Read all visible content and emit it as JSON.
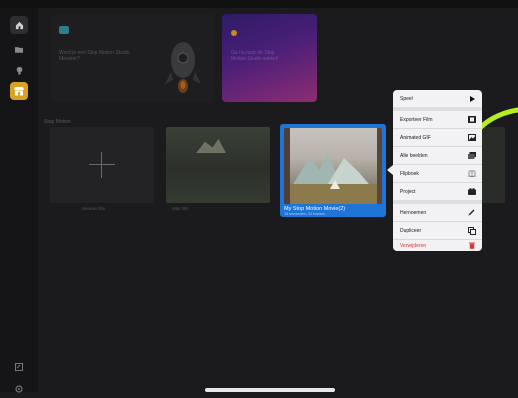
{
  "section_title": "Stop Motion",
  "new_tile_label": "Nieuwe film",
  "banner1_text": "Word je een Stop Motion Studio Meester?",
  "banner2_text": "Ga nu naar de Stop Motion Studio winkel!",
  "tiles": {
    "movie1_label": "Mijn film"
  },
  "selected_movie": {
    "title": "My Stop Motion Movie(2)",
    "subtitle": "15 seconden, 31 frames"
  },
  "menu": {
    "items": [
      {
        "label": "Speel",
        "icon": "play-icon"
      },
      {
        "label": "Exporteer Film",
        "icon": "film-icon"
      },
      {
        "label": "Animated GIF",
        "icon": "image-icon"
      },
      {
        "label": "Alle beelden",
        "icon": "images-icon"
      },
      {
        "label": "Flipboek",
        "icon": "flipbook-icon"
      },
      {
        "label": "Project",
        "icon": "project-icon"
      },
      {
        "label": "Hernoemen",
        "icon": "pencil-icon"
      },
      {
        "label": "Dupliceer",
        "icon": "duplicate-icon"
      },
      {
        "label": "Verwijderen",
        "icon": "trash-icon"
      }
    ]
  },
  "colors": {
    "accent_blue": "#1f74d8",
    "sidebar_store": "#d8a227",
    "danger": "#d23a3a",
    "highlight_green": "#b6ee1e"
  }
}
